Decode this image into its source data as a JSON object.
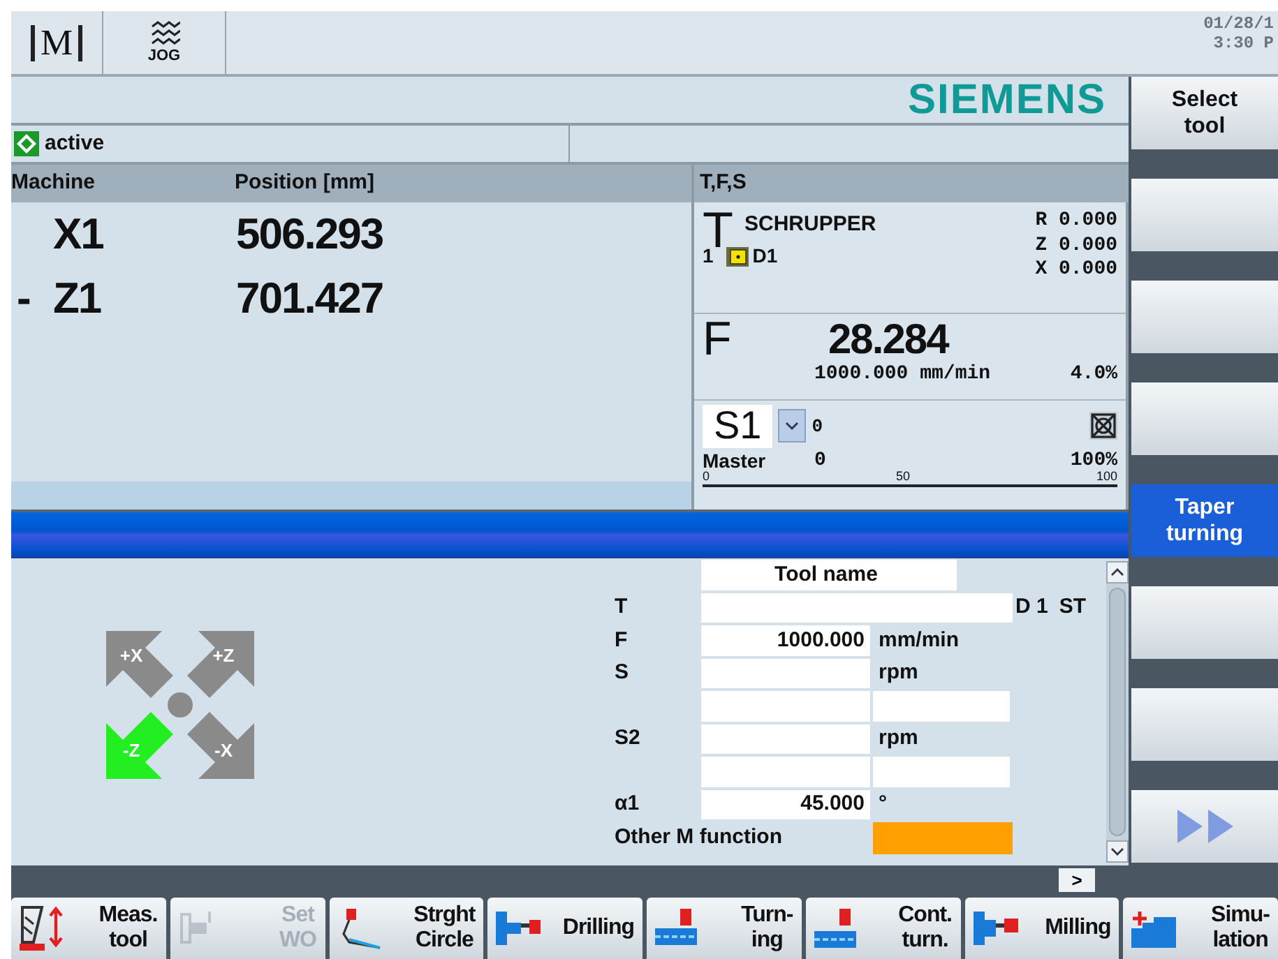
{
  "top_bar": {
    "area_label": "M",
    "mode_label": "JOG",
    "date": "01/28/1",
    "time": "3:30 P"
  },
  "brand": "SIEMENS",
  "status": {
    "text": "active"
  },
  "positions": {
    "columns": [
      "Machine",
      "Position [mm]"
    ],
    "rows": [
      {
        "axis": "X1",
        "value": "506.293"
      },
      {
        "prefix": "-",
        "axis": "Z1",
        "value": "701.427"
      }
    ]
  },
  "tfs": {
    "title": "T,F,S",
    "tool_letter": "T",
    "tool_name": "SCHRUPPER",
    "tool_number": "1",
    "edge": "D1",
    "offsets": [
      "R 0.000",
      "Z 0.000",
      "X 0.000"
    ],
    "feed_letter": "F",
    "feed": "28.284",
    "feed_rate": "1000.000 mm/min",
    "feed_override": "4.0%",
    "spindle": "S1",
    "spindle_speed": "0",
    "spindle_mode": "Master",
    "spindle_value": "0",
    "spindle_override": "100%",
    "scale_ticks": [
      "0",
      "50",
      "100"
    ]
  },
  "jog": {
    "arrows": [
      {
        "label": "+X",
        "selected": false
      },
      {
        "label": "+Z",
        "selected": false
      },
      {
        "label": "-Z",
        "selected": true
      },
      {
        "label": "-X",
        "selected": false
      }
    ]
  },
  "form": {
    "header": "Tool name",
    "rows": [
      {
        "kind": "tool",
        "label": "T",
        "edge": "D 1",
        "unit": "ST"
      },
      {
        "kind": "value",
        "label": "F",
        "value": "1000.000",
        "unit": "mm/min"
      },
      {
        "kind": "value",
        "label": "S",
        "unit": "rpm"
      },
      {
        "kind": "blank"
      },
      {
        "kind": "value",
        "label": "S2",
        "unit": "rpm"
      },
      {
        "kind": "blank"
      },
      {
        "kind": "value",
        "label": "α1",
        "value": "45.000",
        "unit": "°"
      },
      {
        "kind": "choice",
        "label": "Other M function"
      }
    ],
    "next_page": ">"
  },
  "side_softkeys": [
    {
      "kind": "text",
      "label": "Select tool",
      "selected": false
    },
    {
      "kind": "blank",
      "selected": false
    },
    {
      "kind": "blank",
      "selected": false
    },
    {
      "kind": "blank",
      "selected": false
    },
    {
      "kind": "text",
      "label": "Taper turning",
      "selected": true
    },
    {
      "kind": "blank",
      "selected": false
    },
    {
      "kind": "blank",
      "selected": false
    },
    {
      "kind": "more",
      "selected": false
    }
  ],
  "bottom_softkeys": [
    {
      "kind": "measure",
      "lines": [
        "Meas.",
        "tool"
      ],
      "disabled": false
    },
    {
      "kind": "workoffset",
      "lines": [
        "Set",
        "WO"
      ],
      "disabled": true
    },
    {
      "kind": "line",
      "lines": [
        "Strght",
        "Circle"
      ],
      "disabled": false
    },
    {
      "kind": "drilling",
      "lines": [
        "Drilling"
      ],
      "disabled": false
    },
    {
      "kind": "turning",
      "lines": [
        "Turn-",
        "ing"
      ],
      "disabled": false
    },
    {
      "kind": "contour",
      "lines": [
        "Cont.",
        "turn."
      ],
      "disabled": false
    },
    {
      "kind": "milling",
      "lines": [
        "Milling"
      ],
      "disabled": false
    },
    {
      "kind": "simulation",
      "lines": [
        "Simu-",
        "lation"
      ],
      "disabled": false
    }
  ]
}
